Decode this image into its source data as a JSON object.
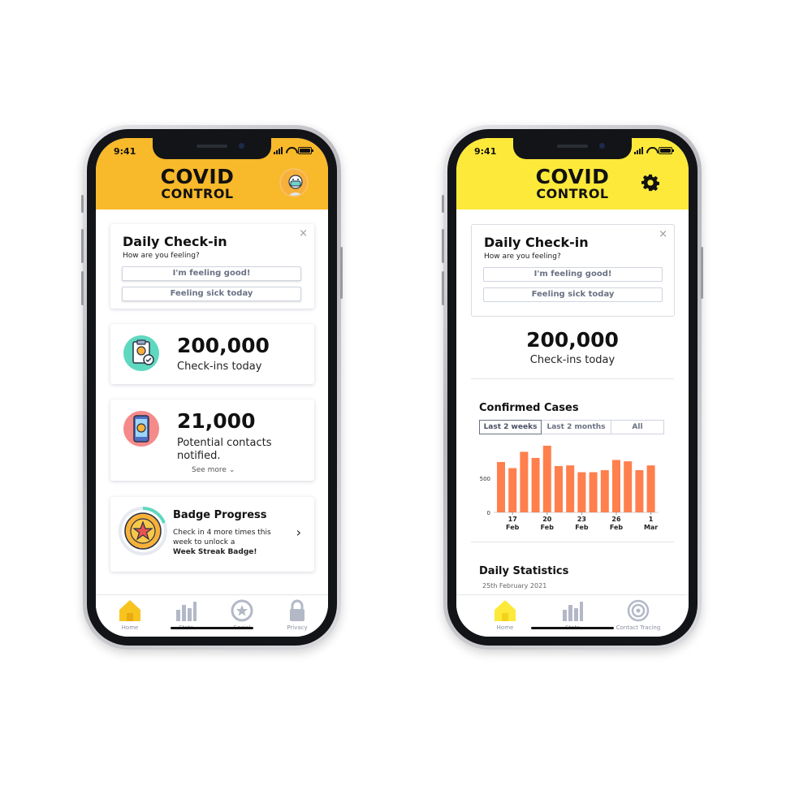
{
  "phone_left": {
    "status_time": "9:41",
    "header_color": "#f8b92a",
    "logo": {
      "line1": "COVID",
      "line2": "CONTROL"
    },
    "checkin": {
      "title": "Daily Check-in",
      "subtitle": "How are you feeling?",
      "close": "×",
      "good_label": "I'm feeling good!",
      "sick_label": "Feeling sick today"
    },
    "stat1": {
      "number": "200,000",
      "label": "Check-ins today"
    },
    "stat2": {
      "number": "21,000",
      "label": "Potential contacts notified.",
      "see_more": "See more"
    },
    "badge": {
      "title": "Badge Progress",
      "text_line1": "Check in 4 more times this",
      "text_line2": "week to unlock a",
      "text_bold": "Week Streak Badge!"
    },
    "tabs": [
      "Home",
      "Stats",
      "Social",
      "Privacy"
    ]
  },
  "phone_right": {
    "status_time": "9:41",
    "header_color": "#fde93a",
    "logo": {
      "line1": "COVID",
      "line2": "CONTROL"
    },
    "checkin": {
      "title": "Daily Check-in",
      "subtitle": "How are you feeling?",
      "close": "×",
      "good_label": "I'm feeling good!",
      "sick_label": "Feeling sick today"
    },
    "stat": {
      "number": "200,000",
      "label": "Check-ins today"
    },
    "chart_title": "Confirmed Cases",
    "ranges": [
      "Last 2 weeks",
      "Last 2 months",
      "All"
    ],
    "daily_title": "Daily Statistics",
    "daily_sub": "25th February 2021",
    "tabs": [
      "Home",
      "Stats",
      "Contact Tracing"
    ]
  },
  "colors": {
    "accent_orange": "#ff7f4d",
    "tab_active": "#f7c41f",
    "tab_inactive": "#b3b8c7"
  },
  "chart_data": {
    "type": "bar",
    "title": "Confirmed Cases",
    "categories": [
      "16 Feb",
      "17 Feb",
      "18 Feb",
      "19 Feb",
      "20 Feb",
      "21 Feb",
      "22 Feb",
      "23 Feb",
      "24 Feb",
      "25 Feb",
      "26 Feb",
      "27 Feb",
      "28 Feb",
      "1 Mar"
    ],
    "values": [
      740,
      650,
      890,
      800,
      980,
      680,
      690,
      590,
      590,
      620,
      770,
      750,
      620,
      690
    ],
    "x_tick_labels": [
      {
        "index": 1,
        "day": "17",
        "month": "Feb"
      },
      {
        "index": 4,
        "day": "20",
        "month": "Feb"
      },
      {
        "index": 7,
        "day": "23",
        "month": "Feb"
      },
      {
        "index": 10,
        "day": "26",
        "month": "Feb"
      },
      {
        "index": 13,
        "day": "1",
        "month": "Mar"
      }
    ],
    "y_ticks": [
      0,
      500
    ],
    "ylim": [
      0,
      1050
    ],
    "grid": false,
    "bar_color": "#ff7f4d"
  }
}
